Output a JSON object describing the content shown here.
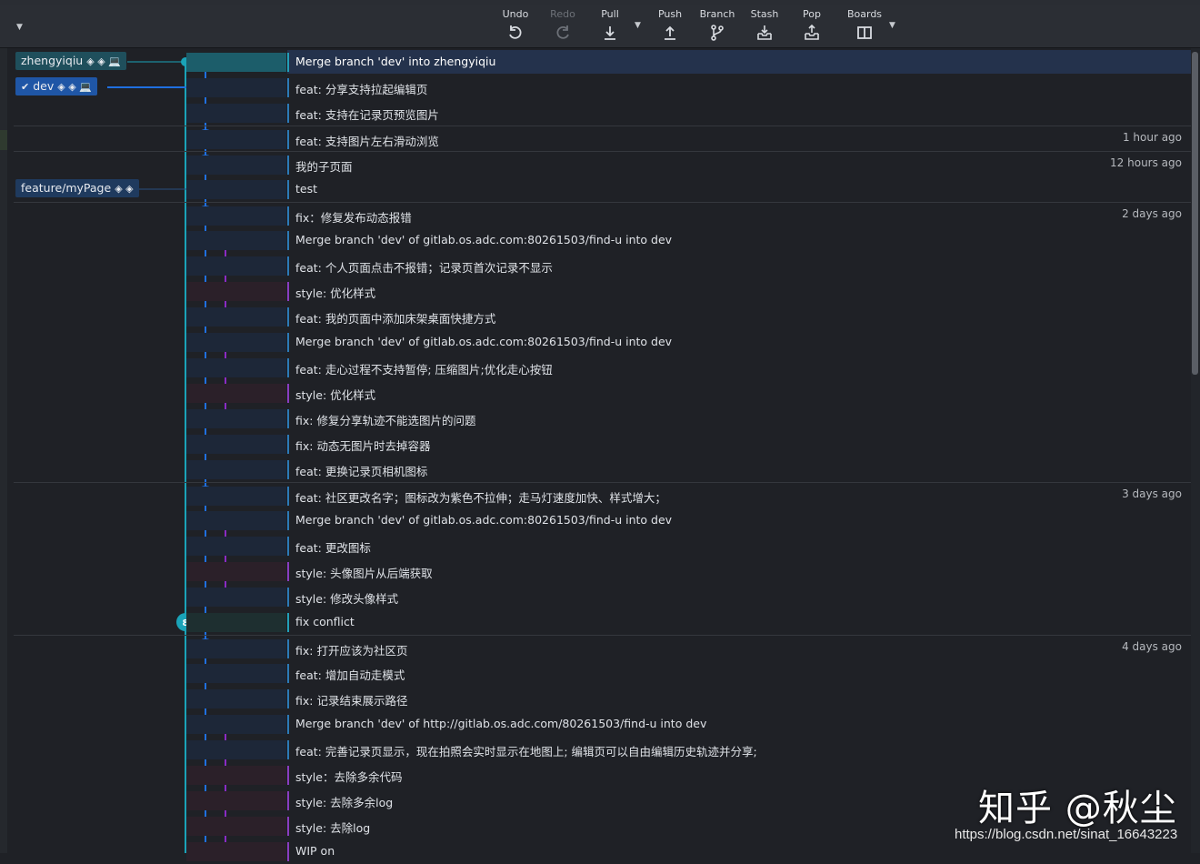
{
  "toolbar": {
    "undo": "Undo",
    "redo": "Redo",
    "pull": "Pull",
    "push": "Push",
    "branch": "Branch",
    "stash": "Stash",
    "pop": "Pop",
    "boards": "Boards"
  },
  "refs": {
    "zhengyiqiu": "zhengyiqiu",
    "dev": "dev",
    "feature": "feature/myPage"
  },
  "commits": [
    {
      "msg": "Merge branch 'dev' into zhengyiqiu",
      "time": "",
      "node": ""
    },
    {
      "msg": "feat: 分享支持拉起编辑页",
      "time": "",
      "node": "X"
    },
    {
      "msg": "feat: 支持在记录页预览图片",
      "time": "",
      "node": "X"
    },
    {
      "msg": "feat: 支持图片左右滑动浏览",
      "time": "1 hour ago",
      "node": "8"
    },
    {
      "msg": "我的子页面",
      "time": "12 hours ago",
      "node": "U"
    },
    {
      "msg": "test",
      "time": "",
      "node": "U"
    },
    {
      "msg": "fix：修复发布动态报错",
      "time": "2 days ago",
      "node": "8"
    },
    {
      "msg": "Merge branch 'dev' of gitlab.os.adc.com:80261503/find-u into dev",
      "time": "",
      "node": ""
    },
    {
      "msg": "feat: 个人页面点击不报错；记录页首次记录不显示",
      "time": "",
      "node": "X"
    },
    {
      "msg": "style: 优化样式",
      "time": "",
      "node": "8"
    },
    {
      "msg": "feat: 我的页面中添加床架桌面快捷方式",
      "time": "",
      "node": "X"
    },
    {
      "msg": "Merge branch 'dev' of gitlab.os.adc.com:80261503/find-u into dev",
      "time": "",
      "node": ""
    },
    {
      "msg": "feat: 走心过程不支持暂停; 压缩图片;优化走心按钮",
      "time": "",
      "node": "X"
    },
    {
      "msg": "style: 优化样式",
      "time": "",
      "node": "8"
    },
    {
      "msg": "fix: 修复分享轨迹不能选图片的问题",
      "time": "",
      "node": "8"
    },
    {
      "msg": "fix: 动态无图片时去掉容器",
      "time": "",
      "node": "8"
    },
    {
      "msg": "feat: 更换记录页相机图标",
      "time": "",
      "node": "X"
    },
    {
      "msg": "feat: 社区更改名字；图标改为紫色不拉伸；走马灯速度加快、样式增大；",
      "time": "3 days ago",
      "node": "X"
    },
    {
      "msg": "Merge branch 'dev' of gitlab.os.adc.com:80261503/find-u into dev",
      "time": "",
      "node": ""
    },
    {
      "msg": "feat: 更改图标",
      "time": "",
      "node": "X"
    },
    {
      "msg": "style: 头像图片从后端获取",
      "time": "",
      "node": "8"
    },
    {
      "msg": "style: 修改头像样式",
      "time": "",
      "node": "8"
    },
    {
      "msg": "fix conflict",
      "time": "",
      "node": "8"
    },
    {
      "msg": "fix: 打开应该为社区页",
      "time": "4 days ago",
      "node": "X"
    },
    {
      "msg": "feat: 增加自动走模式",
      "time": "",
      "node": "X"
    },
    {
      "msg": "fix: 记录结束展示路径",
      "time": "",
      "node": "X"
    },
    {
      "msg": "Merge branch 'dev' of http://gitlab.os.adc.com/80261503/find-u into dev",
      "time": "",
      "node": ""
    },
    {
      "msg": "feat: 完善记录页显示，现在拍照会实时显示在地图上; 编辑页可以自由编辑历史轨迹并分享;",
      "time": "",
      "node": "X"
    },
    {
      "msg": "style：去除多余代码",
      "time": "",
      "node": "8"
    },
    {
      "msg": "style: 去除多余log",
      "time": "",
      "node": "8"
    },
    {
      "msg": "style: 去除log",
      "time": "",
      "node": "U"
    },
    {
      "msg": "WIP on",
      "time": "",
      "node": ""
    }
  ],
  "watermark": {
    "text": "知乎 @秋尘",
    "url": "https://blog.csdn.net/sinat_16643223"
  },
  "colors": {
    "blue": "#1f6fe0",
    "purple": "#8a2bc4",
    "teal": "#1aa3b8",
    "selected": "#24324c"
  }
}
